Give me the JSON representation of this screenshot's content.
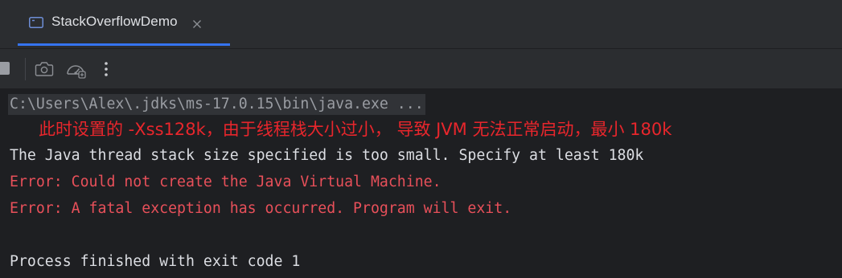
{
  "tab": {
    "label": "StackOverflowDemo",
    "icon": "window-icon",
    "close_icon": "close-icon"
  },
  "toolbar": {
    "items": [
      "stop-icon",
      "camera-icon",
      "gauge-icon",
      "more-vertical-icon"
    ]
  },
  "console": {
    "command_line": "C:\\Users\\Alex\\.jdks\\ms-17.0.15\\bin\\java.exe ...",
    "annotation": "此时设置的 -Xss128k，由于线程栈大小过小， 导致 JVM 无法正常启动，最小 180k",
    "output_line": "The Java thread stack size specified is too small. Specify at least 180k",
    "error_line_1": "Error: Could not create the Java Virtual Machine.",
    "error_line_2": "Error: A fatal exception has occurred. Program will exit.",
    "exit_line": "Process finished with exit code 1"
  },
  "colors": {
    "background": "#1e1f22",
    "panel": "#2b2d30",
    "tab_underline": "#3574f0",
    "error_text": "#e8505a",
    "annotation_text": "#e8262c",
    "normal_text": "#dcdee3",
    "command_text": "#9a9da3"
  }
}
